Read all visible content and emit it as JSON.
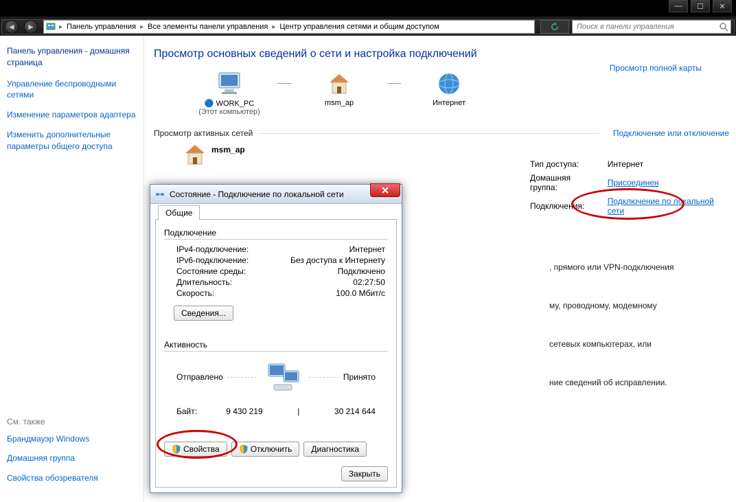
{
  "win_controls": {
    "min": "—",
    "max": "☐",
    "close": "✕"
  },
  "addressbar": {
    "segments": [
      "Панель управления",
      "Все элементы панели управления",
      "Центр управления сетями и общим доступом"
    ]
  },
  "search": {
    "placeholder": "Поиск в панели управления"
  },
  "sidebar": {
    "title": "Панель управления - домашняя страница",
    "links": [
      "Управление беспроводными сетями",
      "Изменение параметров адаптера",
      "Изменить дополнительные параметры общего доступа"
    ],
    "see_also_hdr": "См. также",
    "see_also": [
      "Брандмауэр Windows",
      "Домашняя группа",
      "Свойства обозревателя"
    ]
  },
  "main": {
    "heading": "Просмотр основных сведений о сети и настройка подключений",
    "map_link": "Просмотр полной карты",
    "nodes": [
      {
        "name": "WORK_PC",
        "sub": "(Этот компьютер)",
        "icon": "pc"
      },
      {
        "name": "msm_ap",
        "sub": "",
        "icon": "house"
      },
      {
        "name": "Интернет",
        "sub": "",
        "icon": "globe"
      }
    ],
    "active_hdr": "Просмотр активных сетей",
    "connect_link": "Подключение или отключение",
    "network_name": "msm_ap",
    "details": {
      "access_lbl": "Тип доступа:",
      "access_val": "Интернет",
      "homegrp_lbl": "Домашняя группа:",
      "homegrp_val": "Присоединен",
      "conn_lbl": "Подключения:",
      "conn_val": "Подключение по локальной сети"
    },
    "partials": [
      ", прямого или VPN-подключения",
      "му, проводному, модемному",
      "сетевых компьютерах, или",
      "ние сведений об исправлении."
    ]
  },
  "dialog": {
    "title": "Состояние - Подключение по локальной сети",
    "tab": "Общие",
    "group1": "Подключение",
    "rows": [
      {
        "l": "IPv4-подключение:",
        "v": "Интернет"
      },
      {
        "l": "IPv6-подключение:",
        "v": "Без доступа к Интернету"
      },
      {
        "l": "Состояние среды:",
        "v": "Подключено"
      },
      {
        "l": "Длительность:",
        "v": "02:27:50"
      },
      {
        "l": "Скорость:",
        "v": "100.0 Мбит/с"
      }
    ],
    "details_btn": "Сведения...",
    "group2": "Активность",
    "sent_lbl": "Отправлено",
    "recv_lbl": "Принято",
    "bytes_lbl": "Байт:",
    "sent": "9 430 219",
    "recv": "30 214 644",
    "btn_props": "Свойства",
    "btn_disable": "Отключить",
    "btn_diag": "Диагностика",
    "btn_close": "Закрыть"
  }
}
